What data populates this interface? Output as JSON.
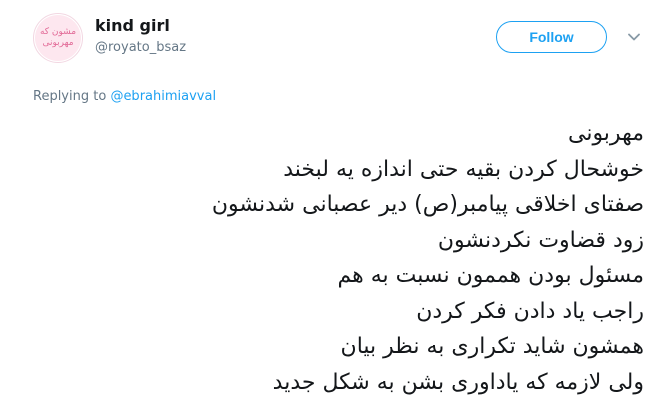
{
  "author": {
    "display_name": "kind girl",
    "handle": "@royato_bsaz",
    "avatar_text": [
      "مشون که",
      "مهربونی"
    ]
  },
  "follow_button": {
    "label": "Follow"
  },
  "reply": {
    "prefix": "Replying to ",
    "mention": "@ebrahimiavval"
  },
  "tweet_lines": [
    "مهربونی",
    "خوشحال کردن بقیه حتی اندازه یه لبخند",
    "صفتای اخلاقی پیامبر(ص) دیر عصبانی شدنشون",
    "زود قضاوت نکردنشون",
    "مسئول بودن هممون نسبت به هم",
    "راجب یاد دادن فکر کردن",
    "همشون شاید تکراری به نظر بیان",
    "ولی لازمه که یاداوری بشن به شکل جدید"
  ],
  "icons": {
    "menu": "chevron-down-icon"
  },
  "colors": {
    "accent": "#1da1f2",
    "muted": "#657786",
    "text": "#14171a"
  }
}
